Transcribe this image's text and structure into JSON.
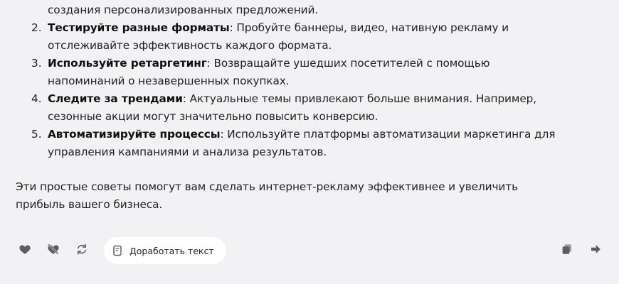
{
  "message": {
    "first_continuation": "создания персонализированных предложений.",
    "items": [
      {
        "number": "2.",
        "title": "Тестируйте разные форматы",
        "line1_rest": ": Пробуйте баннеры, видео, нативную рекламу и",
        "line2": "отслеживайте эффективность каждого формата."
      },
      {
        "number": "3.",
        "title": "Используйте ретаргетинг",
        "line1_rest": ": Возвращайте ушедших посетителей с помощью",
        "line2": "напоминаний о незавершенных покупках."
      },
      {
        "number": "4.",
        "title": "Следите за трендами",
        "line1_rest": ": Актуальные темы привлекают больше внимания. Например,",
        "line2": "сезонные акции могут значительно повысить конверсию."
      },
      {
        "number": "5.",
        "title": "Автоматизируйте процессы",
        "line1_rest": ": Используйте платформы автоматизации маркетинга для",
        "line2": "управления кампаниями и анализа результатов."
      }
    ],
    "summary_line1": "Эти простые советы помогут вам сделать интернет-рекламу эффективнее и увеличить",
    "summary_line2": "прибыль вашего бизнеса."
  },
  "actions": {
    "refine_label": "Доработать текст"
  },
  "colors": {
    "background": "#f2f2f4",
    "icon": "#5c5c62",
    "button_bg": "#ffffff"
  },
  "icons": [
    "heart-icon",
    "dislike-icon",
    "regenerate-icon",
    "refine-icon",
    "copy-icon",
    "share-icon"
  ]
}
